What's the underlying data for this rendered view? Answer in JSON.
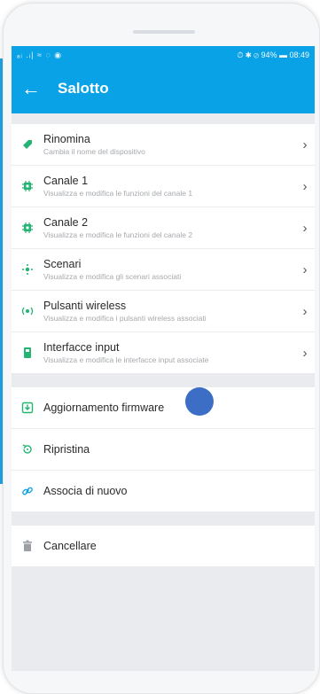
{
  "status_bar": {
    "left": "ₐᵢ .ᵢ| ≈ ◌ ◉",
    "right": "⏱ ✱ ⊘ 94% ▬ 08:49"
  },
  "header": {
    "title": "Salotto"
  },
  "settings": [
    {
      "name": "Rinomina",
      "desc": "Cambia il nome del dispositivo",
      "icon": "tag-icon"
    },
    {
      "name": "Canale 1",
      "desc": "Visualizza e modifica le funzioni del canale 1",
      "icon": "chip-icon"
    },
    {
      "name": "Canale 2",
      "desc": "Visualizza e modifica le funzioni del canale 2",
      "icon": "chip-icon"
    },
    {
      "name": "Scenari",
      "desc": "Visualizza e modifica gli scenari associati",
      "icon": "scene-icon"
    },
    {
      "name": "Pulsanti wireless",
      "desc": "Visualizza e modifica i pulsanti wireless associati",
      "icon": "wireless-icon"
    },
    {
      "name": "Interfacce input",
      "desc": "Visualizza e modifica le interfacce input associate",
      "icon": "input-icon"
    }
  ],
  "actions": [
    {
      "name": "Aggiornamento firmware",
      "icon": "download-icon"
    },
    {
      "name": "Ripristina",
      "icon": "restore-icon"
    },
    {
      "name": "Associa di nuovo",
      "icon": "link-icon"
    }
  ],
  "danger": {
    "name": "Cancellare",
    "icon": "trash-icon"
  },
  "colors": {
    "accent": "#0aa2e6",
    "icon_green": "#22b573",
    "icon_blue": "#0aa2e6",
    "touch": "#3b6ec4"
  }
}
